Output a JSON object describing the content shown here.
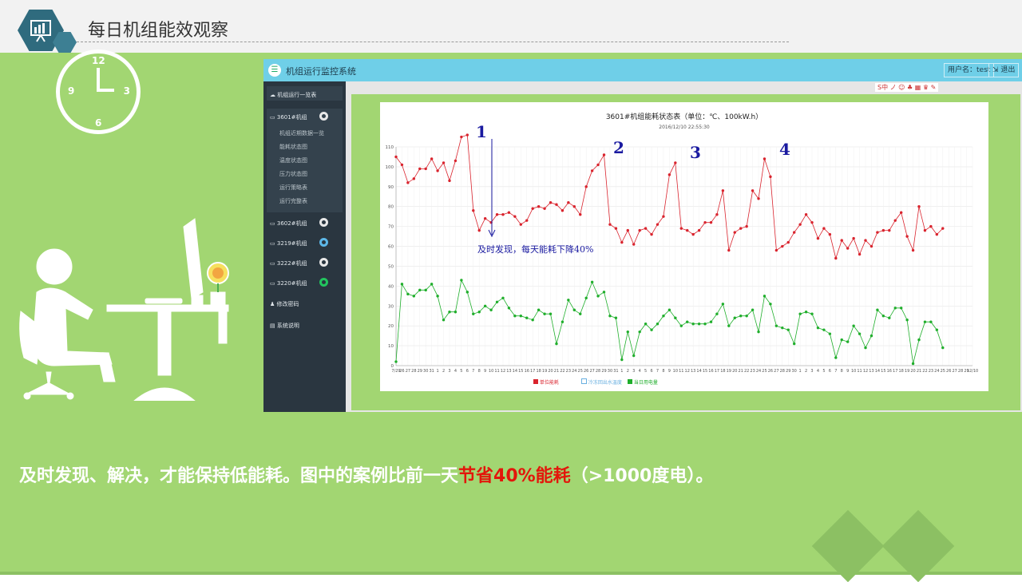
{
  "page": {
    "title": "每日机组能效观察",
    "caption_part1": "及时发现、解决，才能保持低能耗。图中的案例比前一天",
    "caption_highlight": "节省40%能耗",
    "caption_part2": "（>1000度电）。"
  },
  "clock": {
    "n12": "12",
    "n3": "3",
    "n6": "6",
    "n9": "9"
  },
  "app": {
    "title": "机组运行监控系统",
    "user_label": "用户名：test",
    "logout_label": "退出",
    "toolbar": "S中 ノ ☺ ♣ ▦ ♛ ✎"
  },
  "sidebar": {
    "overview": "机组运行一览表",
    "unit_3601": "3601#机组",
    "sub_items": [
      "机组近期数据一览",
      "能耗状态图",
      "温度状态图",
      "压力状态图",
      "运行策略表",
      "运行完整表"
    ],
    "units": [
      "3602#机组",
      "3219#机组",
      "3222#机组",
      "3220#机组"
    ],
    "change_password": "修改密码",
    "manual": "系统说明"
  },
  "chart_data": {
    "type": "line",
    "title": "3601#机组能耗状态表（单位：℃、100kW.h）",
    "subtitle": "2016/12/10 22:55:30",
    "ylim": [
      0,
      110
    ],
    "yticks": [
      0,
      10,
      20,
      30,
      40,
      50,
      60,
      70,
      80,
      90,
      100,
      110
    ],
    "x": [
      "7/29",
      "26",
      "27",
      "28",
      "29",
      "30",
      "31",
      "1",
      "2",
      "3",
      "4",
      "5",
      "6",
      "7",
      "8",
      "9",
      "10",
      "11",
      "12",
      "13",
      "14",
      "15",
      "16",
      "17",
      "18",
      "19",
      "20",
      "21",
      "22",
      "23",
      "24",
      "25",
      "26",
      "27",
      "28",
      "29",
      "30",
      "31",
      "1",
      "2",
      "3",
      "4",
      "5",
      "6",
      "7",
      "8",
      "9",
      "10",
      "11",
      "12",
      "13",
      "14",
      "15",
      "16",
      "17",
      "18",
      "19",
      "20",
      "21",
      "22",
      "23",
      "24",
      "25",
      "26",
      "27",
      "28",
      "29",
      "30",
      "1",
      "2",
      "3",
      "4",
      "5",
      "6",
      "7",
      "8",
      "9",
      "10",
      "11",
      "12",
      "13",
      "14",
      "15",
      "16",
      "17",
      "18",
      "19",
      "20",
      "21",
      "22",
      "23",
      "24",
      "25",
      "26",
      "27",
      "28",
      "29",
      "12/10"
    ],
    "series": [
      {
        "name": "单位能耗",
        "color": "#d9232d",
        "values": [
          105,
          101,
          92,
          94,
          99,
          99,
          104,
          98,
          102,
          93,
          103,
          115,
          116,
          78,
          68,
          74,
          72,
          76,
          76,
          77,
          75,
          71,
          73,
          79,
          80,
          79,
          82,
          81,
          78,
          82,
          80,
          76,
          90,
          98,
          101,
          106,
          71,
          69,
          62,
          68,
          61,
          68,
          69,
          66,
          71,
          75,
          96,
          102,
          69,
          68,
          66,
          68,
          72,
          72,
          76,
          88,
          58,
          67,
          69,
          70,
          88,
          84,
          104,
          95,
          58,
          60,
          62,
          67,
          71,
          76,
          72,
          64,
          69,
          66,
          54,
          63,
          59,
          64,
          56,
          63,
          60,
          67,
          68,
          68,
          73,
          77,
          65,
          58,
          80,
          68,
          70,
          66,
          69
        ]
      },
      {
        "name": "冷冻回出水温度",
        "color": "#6ab0e0",
        "values": []
      },
      {
        "name": "当日用电量",
        "color": "#1fae2b",
        "values": [
          2,
          41,
          36,
          35,
          38,
          38,
          41,
          35,
          23,
          27,
          27,
          43,
          37,
          26,
          27,
          30,
          28,
          32,
          34,
          29,
          25,
          25,
          24,
          23,
          28,
          26,
          26,
          11,
          22,
          33,
          28,
          26,
          34,
          42,
          35,
          37,
          25,
          24,
          3,
          17,
          5,
          17,
          21,
          18,
          21,
          25,
          28,
          24,
          20,
          22,
          21,
          21,
          21,
          22,
          26,
          31,
          20,
          24,
          25,
          25,
          28,
          17,
          35,
          31,
          20,
          19,
          18,
          11,
          26,
          27,
          26,
          19,
          18,
          16,
          4,
          13,
          12,
          20,
          16,
          9,
          15,
          28,
          25,
          24,
          29,
          29,
          23,
          1,
          13,
          22,
          22,
          18,
          9
        ]
      }
    ],
    "annotations": {
      "n1": "1",
      "n2": "2",
      "n3": "3",
      "n4": "4",
      "note": "及时发现，每天能耗下降40%"
    }
  }
}
